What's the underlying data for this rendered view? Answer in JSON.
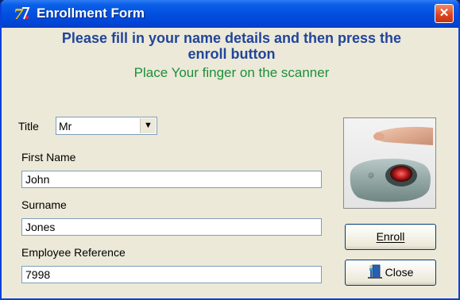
{
  "window": {
    "title": "Enrollment Form",
    "close_glyph": "✕"
  },
  "heading": {
    "line1": "Please fill in your name details and then press the",
    "line2": "enroll button"
  },
  "instruction": "Place Your finger on the scanner",
  "form": {
    "title_label": "Title",
    "title_value": "Mr",
    "first_name_label": "First Name",
    "first_name_value": "John",
    "surname_label": "Surname",
    "surname_value": "Jones",
    "employee_ref_label": "Employee Reference",
    "employee_ref_value": "7998"
  },
  "buttons": {
    "enroll_label": "Enroll",
    "close_label": "Close"
  },
  "colors": {
    "heading": "#22459a",
    "instruction": "#1d8f3a",
    "titlebar": "#0350e0"
  },
  "icons": [
    "app-logo-icon",
    "close-icon",
    "dropdown-arrow-icon",
    "fingerprint-scanner-image",
    "exit-door-icon"
  ]
}
